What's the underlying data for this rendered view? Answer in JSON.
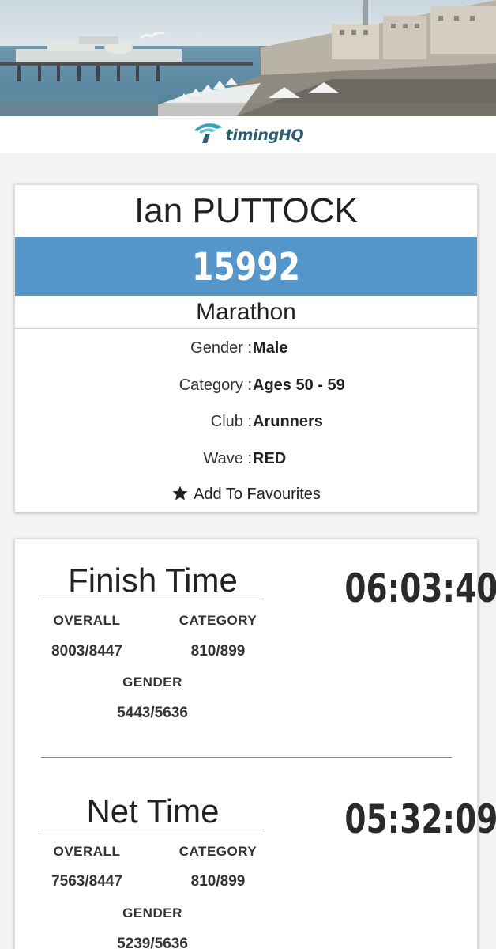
{
  "brand": {
    "logo_text": "timingHQ",
    "accent": "#2e5d73",
    "logo_color": "#3aa7b9"
  },
  "athlete": {
    "name": "Ian PUTTOCK",
    "bib": "15992",
    "bib_color": "#5496c9",
    "race": "Marathon",
    "details": [
      {
        "label": "Gender :",
        "value": "Male"
      },
      {
        "label": "Category :",
        "value": "Ages 50 - 59"
      },
      {
        "label": "Club :",
        "value": "Arunners"
      },
      {
        "label": "Wave :",
        "value": "RED"
      }
    ],
    "favourite_label": "Add To Favourites"
  },
  "results": [
    {
      "title": "Finish Time",
      "time": "06:03:40",
      "overall_label": "OVERALL",
      "overall": "8003/8447",
      "category_label": "CATEGORY",
      "category": "810/899",
      "gender_label": "GENDER",
      "gender": "5443/5636"
    },
    {
      "title": "Net Time",
      "time": "05:32:09",
      "overall_label": "OVERALL",
      "overall": "7563/8447",
      "category_label": "CATEGORY",
      "category": "810/899",
      "gender_label": "GENDER",
      "gender": "5239/5636"
    }
  ]
}
